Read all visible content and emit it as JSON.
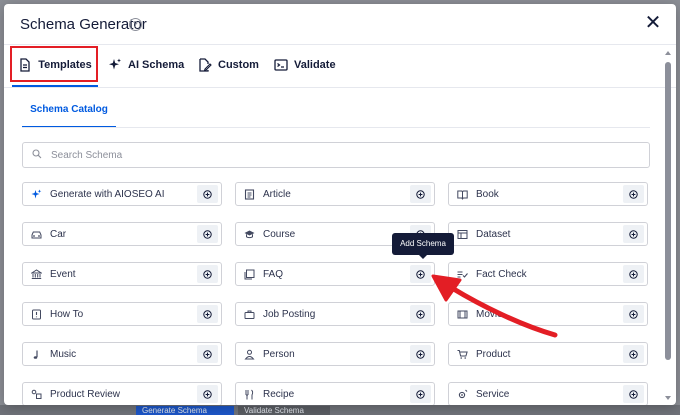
{
  "modal": {
    "title": "Schema Generator",
    "help_icon": "question-circle-icon",
    "close_label": "✕"
  },
  "tabs": [
    {
      "label": "Templates",
      "icon": "document-icon",
      "active": true
    },
    {
      "label": "AI Schema",
      "icon": "sparkles-icon",
      "active": false
    },
    {
      "label": "Custom",
      "icon": "edit-document-icon",
      "active": false
    },
    {
      "label": "Validate",
      "icon": "terminal-icon",
      "active": false
    }
  ],
  "catalog": {
    "subtab_label": "Schema Catalog",
    "search_placeholder": "Search Schema",
    "items": [
      {
        "label": "Generate with AIOSEO AI",
        "icon": "sparkles-icon"
      },
      {
        "label": "Article",
        "icon": "article-icon"
      },
      {
        "label": "Book",
        "icon": "book-icon"
      },
      {
        "label": "Car",
        "icon": "car-icon"
      },
      {
        "label": "Course",
        "icon": "graduation-cap-icon"
      },
      {
        "label": "Dataset",
        "icon": "dataset-icon"
      },
      {
        "label": "Event",
        "icon": "building-icon"
      },
      {
        "label": "FAQ",
        "icon": "faq-icon"
      },
      {
        "label": "Fact Check",
        "icon": "fact-check-icon"
      },
      {
        "label": "How To",
        "icon": "howto-icon"
      },
      {
        "label": "Job Posting",
        "icon": "briefcase-icon"
      },
      {
        "label": "Movie",
        "icon": "movie-icon"
      },
      {
        "label": "Music",
        "icon": "music-note-icon"
      },
      {
        "label": "Person",
        "icon": "person-icon"
      },
      {
        "label": "Product",
        "icon": "cart-icon"
      },
      {
        "label": "Product Review",
        "icon": "review-icon"
      },
      {
        "label": "Recipe",
        "icon": "recipe-icon"
      },
      {
        "label": "Service",
        "icon": "service-icon"
      }
    ]
  },
  "tooltip": {
    "text": "Add Schema"
  },
  "background_buttons": {
    "primary": "Generate Schema",
    "secondary": "Validate Schema"
  },
  "colors": {
    "accent": "#005ae0",
    "highlight": "#e31e25",
    "arrow": "#e31e25",
    "tooltip_bg": "#141b38"
  }
}
